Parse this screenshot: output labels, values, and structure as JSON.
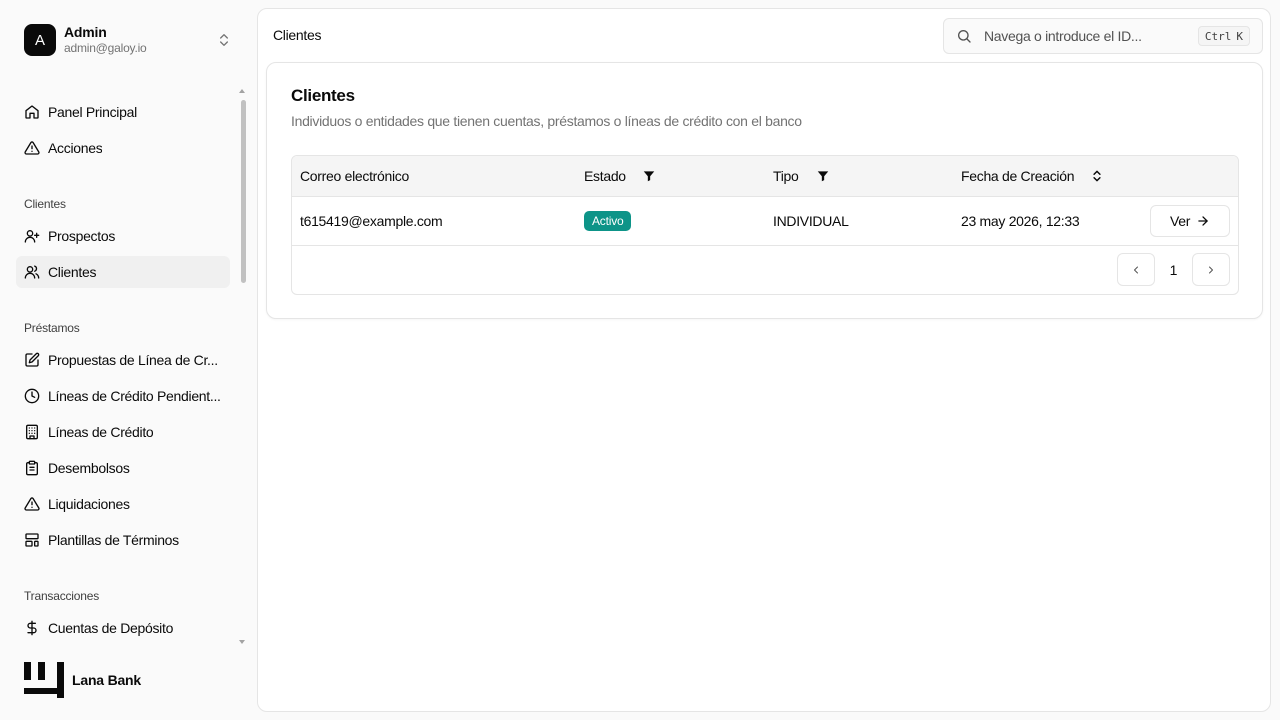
{
  "user": {
    "initial": "A",
    "name": "Admin",
    "email": "admin@galoy.io"
  },
  "nav": {
    "items_top": [
      {
        "label": "Panel Principal",
        "icon": "home-icon"
      },
      {
        "label": "Acciones",
        "icon": "warning-icon"
      }
    ],
    "group_clientes": "Clientes",
    "items_clientes": [
      {
        "label": "Prospectos",
        "icon": "user-plus-icon"
      },
      {
        "label": "Clientes",
        "icon": "users-icon",
        "active": true
      }
    ],
    "group_prestamos": "Préstamos",
    "items_prestamos": [
      {
        "label": "Propuestas de Línea de Cr...",
        "icon": "file-edit-icon"
      },
      {
        "label": "Líneas de Crédito Pendient...",
        "icon": "clock-icon"
      },
      {
        "label": "Líneas de Crédito",
        "icon": "building-icon"
      },
      {
        "label": "Desembolsos",
        "icon": "clipboard-icon"
      },
      {
        "label": "Liquidaciones",
        "icon": "warning-icon"
      },
      {
        "label": "Plantillas de Términos",
        "icon": "layout-template-icon"
      }
    ],
    "group_transacciones": "Transacciones",
    "items_transacciones": [
      {
        "label": "Cuentas de Depósito",
        "icon": "dollar-icon"
      }
    ]
  },
  "brand": {
    "name": "Lana Bank"
  },
  "topbar": {
    "title": "Clientes",
    "search_placeholder": "Navega o introduce el ID...",
    "shortcut_ctrl": "Ctrl",
    "shortcut_key": "K"
  },
  "card": {
    "title": "Clientes",
    "description": "Individuos o entidades que tienen cuentas, préstamos o líneas de crédito con el banco"
  },
  "table": {
    "columns": [
      "Correo electrónico",
      "Estado",
      "Tipo",
      "Fecha de Creación"
    ],
    "rows": [
      {
        "email": "t615419@example.com",
        "status": "Activo",
        "type": "INDIVIDUAL",
        "created": "23 may 2026, 12:33",
        "action": "Ver"
      }
    ],
    "page": "1"
  },
  "colors": {
    "status_active": "#0d9488",
    "primary": "#0a0a0a"
  }
}
